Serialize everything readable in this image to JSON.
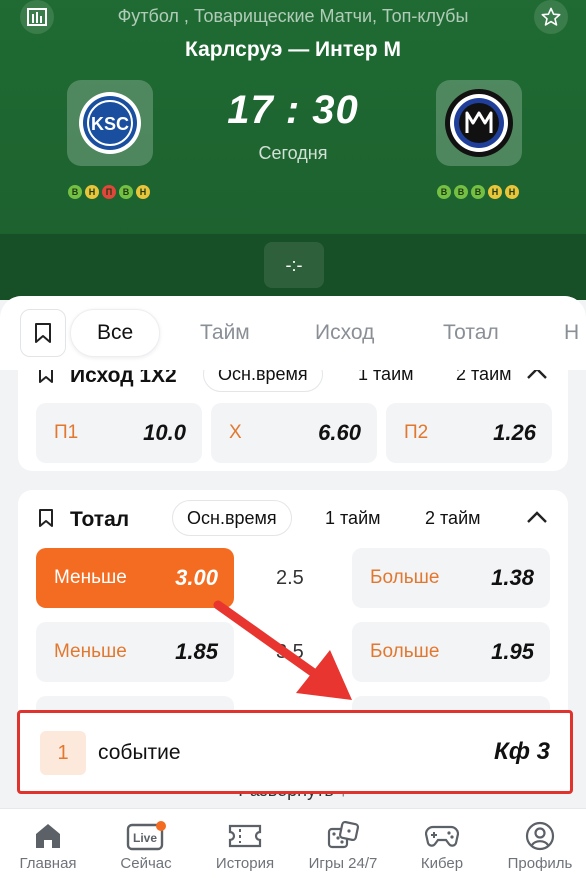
{
  "header": {
    "category": "Футбол , Товарищеские Матчи, Топ-клубы",
    "match_title": "Карлсруэ — Интер М",
    "time": "17 : 30",
    "date": "Сегодня",
    "score": "-:-",
    "home_logo_text": "KSC",
    "home_form": [
      "В",
      "Н",
      "П",
      "В",
      "Н"
    ],
    "away_form": [
      "В",
      "В",
      "В",
      "Н",
      "Н"
    ]
  },
  "filters": {
    "tabs": [
      "Все",
      "Тайм",
      "Исход",
      "Тотал",
      "Н"
    ]
  },
  "market_outcome": {
    "title": "Исход 1Х2",
    "segments": [
      "Осн.время",
      "1 тайм",
      "2 тайм"
    ],
    "odds": [
      {
        "label": "П1",
        "value": "10.0"
      },
      {
        "label": "Х",
        "value": "6.60"
      },
      {
        "label": "П2",
        "value": "1.26"
      }
    ]
  },
  "market_total": {
    "title": "Тотал",
    "segments": [
      "Осн.время",
      "1 тайм",
      "2 тайм"
    ],
    "rows": [
      {
        "under_label": "Меньше",
        "under": "3.00",
        "line": "2.5",
        "over_label": "Больше",
        "over": "1.38"
      },
      {
        "under_label": "Меньше",
        "under": "1.85",
        "line": "3.5",
        "over_label": "Больше",
        "over": "1.95"
      }
    ]
  },
  "expand_label": "Развернуть",
  "slip": {
    "count": "1",
    "label": "событие",
    "coef": "Кф 3"
  },
  "nav": [
    {
      "label": "Главная",
      "icon": "home-icon"
    },
    {
      "label": "Сейчас",
      "icon": "live-icon",
      "icon_text": "Live"
    },
    {
      "label": "История",
      "icon": "ticket-icon"
    },
    {
      "label": "Игры 24/7",
      "icon": "dice-icon"
    },
    {
      "label": "Кибер",
      "icon": "gamepad-icon"
    },
    {
      "label": "Профиль",
      "icon": "profile-icon"
    }
  ],
  "colors": {
    "header_green": "#1f6b33",
    "accent_orange": "#f36c21",
    "highlight_red": "#e0332e"
  }
}
